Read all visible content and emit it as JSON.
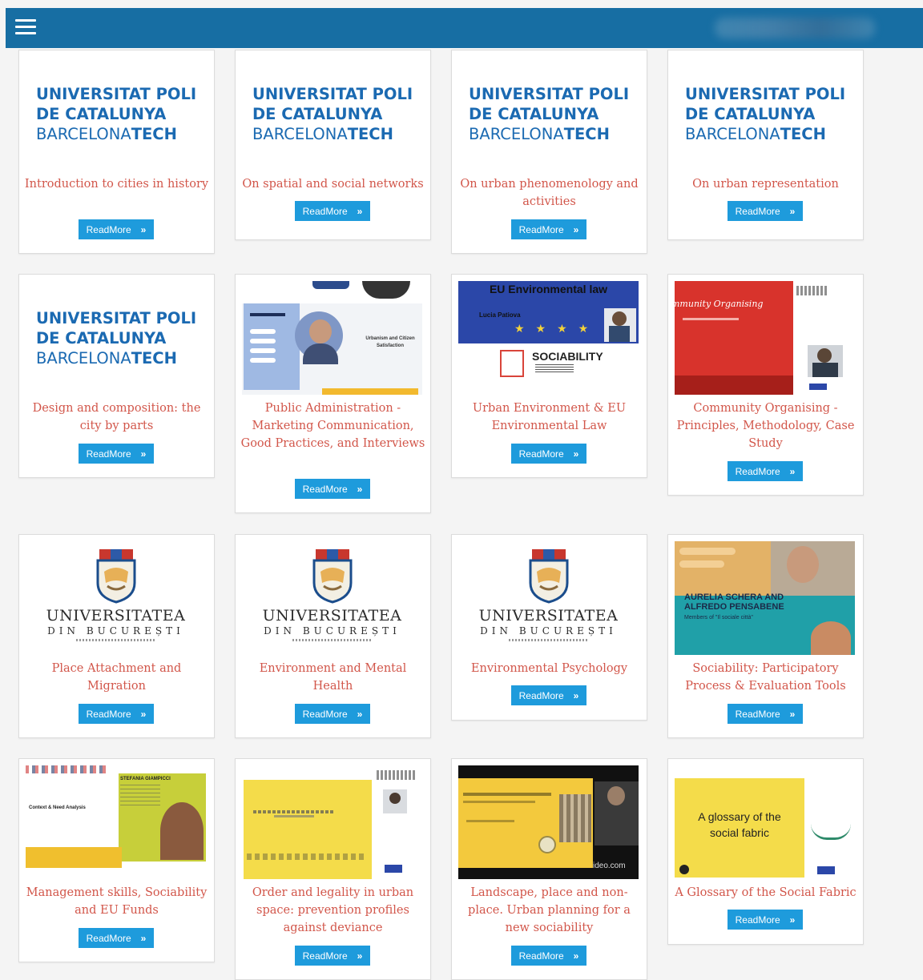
{
  "colors": {
    "header": "#176ea3",
    "title": "#d2564a",
    "button": "#1e9bdc"
  },
  "icons": {
    "menu": "hamburger-menu-icon",
    "chevron": "chevron-right-icon"
  },
  "readmore_label": "ReadMore",
  "readmore_chevron": "»",
  "upc_logo": {
    "line1": "UNIVERSITAT POLI",
    "line2": "DE CATALUNYA",
    "line3a": "BARCELONA",
    "line3b": "TECH"
  },
  "unibuc_logo": {
    "line1": "UNIVERSITATEA",
    "line2": "DIN BUCUREȘTI"
  },
  "thumbs": {
    "public_admin": {
      "line1": "Urbanism and Citizen",
      "line2": "Satisfaction"
    },
    "eu_env": {
      "heading": "EU Environmental law",
      "name": "Lucia Patiova",
      "brand": "SOCIABILITY"
    },
    "community": {
      "script": "mmunity Organising"
    },
    "sociability_tools": {
      "line1": "AURELIA SCHERA AND",
      "line2": "ALFREDO PENSABENE",
      "line3": "Members of \"Il sociale città\""
    },
    "management": {
      "left": "Context & Need Analysis",
      "name": "STEFANIA GIAMPICCI"
    },
    "landscape": {
      "watermark": "ideo.com"
    },
    "glossary": {
      "line1": "A glossary of the",
      "line2": "social fabric"
    }
  },
  "cards": [
    {
      "title": "Introduction to cities in history"
    },
    {
      "title": "On spatial and social networks"
    },
    {
      "title": "On urban phenomenology and activities"
    },
    {
      "title": "On urban representation"
    },
    {
      "title": "Design and composition: the city by parts"
    },
    {
      "title": "Public Administration - Marketing Communication, Good Practices, and Interviews"
    },
    {
      "title": "Urban Environment & EU Environmental Law"
    },
    {
      "title": "Community Organising - Principles, Methodology, Case Study"
    },
    {
      "title": "Place Attachment and Migration"
    },
    {
      "title": "Environment and Mental Health"
    },
    {
      "title": "Environmental Psychology"
    },
    {
      "title": "Sociability: Participatory Process & Evaluation Tools"
    },
    {
      "title": "Management skills, Sociability and EU Funds"
    },
    {
      "title": "Order and legality in urban space: prevention profiles against deviance"
    },
    {
      "title": "Landscape, place and non-place. Urban planning for a new sociability"
    },
    {
      "title": "A Glossary of the Social Fabric"
    }
  ]
}
